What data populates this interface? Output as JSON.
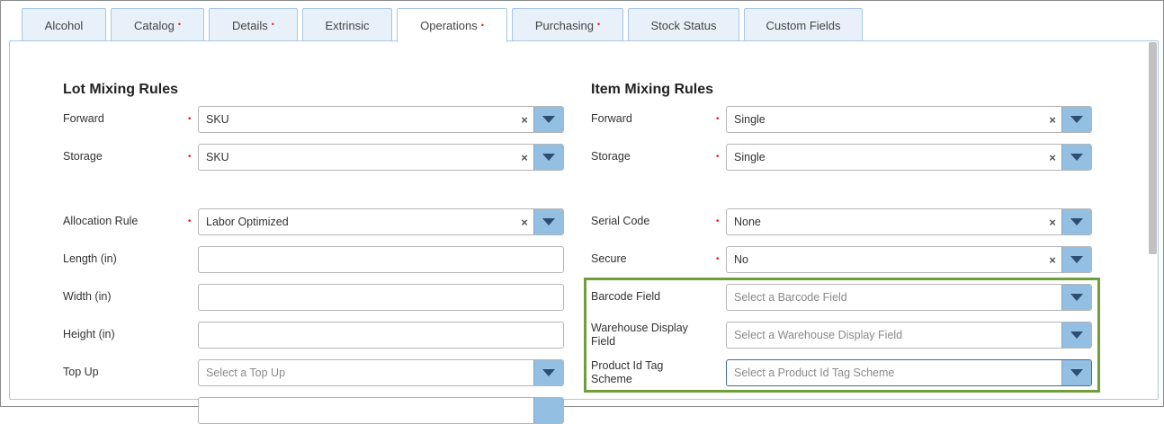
{
  "tabs": [
    {
      "label": "Alcohol",
      "required": false
    },
    {
      "label": "Catalog",
      "required": true
    },
    {
      "label": "Details",
      "required": true
    },
    {
      "label": "Extrinsic",
      "required": false
    },
    {
      "label": "Operations",
      "required": true
    },
    {
      "label": "Purchasing",
      "required": true
    },
    {
      "label": "Stock Status",
      "required": false
    },
    {
      "label": "Custom Fields",
      "required": false
    }
  ],
  "required_mark": "•",
  "lot": {
    "title": "Lot Mixing Rules",
    "forward": {
      "label": "Forward",
      "value": "SKU"
    },
    "storage": {
      "label": "Storage",
      "value": "SKU"
    }
  },
  "item": {
    "title": "Item Mixing Rules",
    "forward": {
      "label": "Forward",
      "value": "Single"
    },
    "storage": {
      "label": "Storage",
      "value": "Single"
    }
  },
  "left": {
    "allocation_rule": {
      "label": "Allocation Rule",
      "value": "Labor Optimized"
    },
    "length": {
      "label": "Length (in)",
      "value": ""
    },
    "width": {
      "label": "Width (in)",
      "value": ""
    },
    "height": {
      "label": "Height (in)",
      "value": ""
    },
    "top_up": {
      "label": "Top Up",
      "placeholder": "Select a Top Up"
    }
  },
  "right": {
    "serial_code": {
      "label": "Serial Code",
      "value": "None"
    },
    "secure": {
      "label": "Secure",
      "value": "No"
    },
    "barcode_field": {
      "label": "Barcode Field",
      "placeholder": "Select a Barcode Field"
    },
    "warehouse_display_field": {
      "label_line1": "Warehouse Display",
      "label_line2": "Field",
      "placeholder": "Select a Warehouse Display Field"
    },
    "product_id_tag_scheme": {
      "label_line1": "Product Id Tag",
      "label_line2": "Scheme",
      "placeholder": "Select a Product Id Tag Scheme"
    }
  },
  "icons": {
    "clear": "×",
    "dropdown": "caret-down-icon"
  },
  "colors": {
    "highlight": "#6f9e3a",
    "dropdown_bg": "#93bfe3",
    "required": "#e02020",
    "tab_bg": "#e8f1f9"
  }
}
